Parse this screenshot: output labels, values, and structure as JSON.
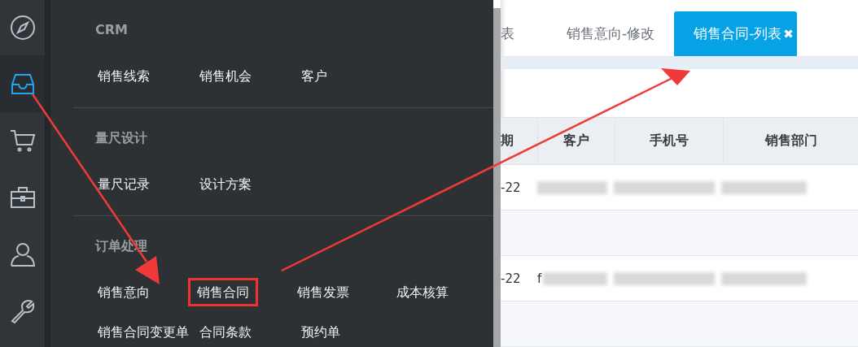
{
  "rail": [
    {
      "selected": false
    },
    {
      "selected": true
    },
    {
      "selected": false
    },
    {
      "selected": false
    },
    {
      "selected": false
    },
    {
      "selected": false
    }
  ],
  "menu": {
    "sections": [
      {
        "title": "CRM",
        "rows": [
          [
            {
              "label": "销售线索",
              "highlighted": false
            },
            {
              "label": "销售机会",
              "highlighted": false
            },
            {
              "label": "客户",
              "highlighted": false
            }
          ]
        ]
      },
      {
        "title": "量尺设计",
        "rows": [
          [
            {
              "label": "量尺记录",
              "highlighted": false
            },
            {
              "label": "设计方案",
              "highlighted": false
            }
          ]
        ]
      },
      {
        "title": "订单处理",
        "rows": [
          [
            {
              "label": "销售意向",
              "highlighted": false
            },
            {
              "label": "销售合同",
              "highlighted": true
            },
            {
              "label": "销售发票",
              "highlighted": false
            },
            {
              "label": "成本核算",
              "highlighted": false
            }
          ],
          [
            {
              "label": "销售合同变更单",
              "highlighted": false
            },
            {
              "label": "合同条款",
              "highlighted": false
            },
            {
              "label": "预约单",
              "highlighted": false
            }
          ]
        ]
      }
    ]
  },
  "tabs": [
    {
      "label": "表",
      "selected": false
    },
    {
      "label": "销售意向-修改",
      "selected": false
    },
    {
      "label": "销售合同-列表",
      "selected": true,
      "close": "✖"
    }
  ],
  "table": {
    "columns": [
      "期",
      "客户",
      "手机号",
      "销售部门"
    ],
    "rows": [
      {
        "kind": "data",
        "cells": [
          {
            "text": "-22"
          },
          {
            "blurred": true
          },
          {
            "blurred": true
          },
          {
            "blurred": true
          }
        ]
      },
      {
        "kind": "blank"
      },
      {
        "kind": "data",
        "cells": [
          {
            "text": "-22"
          },
          {
            "text": "f",
            "blurred": true
          },
          {
            "blurred": true
          },
          {
            "blurred": true
          }
        ]
      },
      {
        "kind": "blank"
      }
    ]
  }
}
